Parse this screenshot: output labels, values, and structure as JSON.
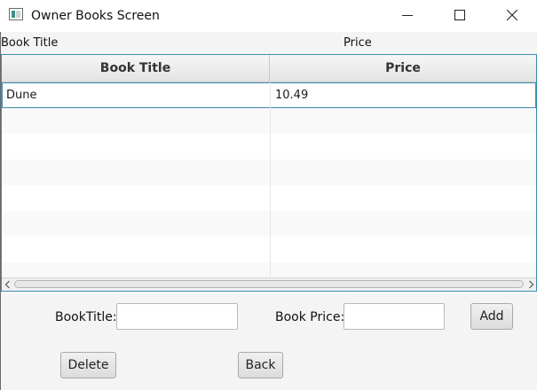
{
  "window": {
    "title": "Owner Books Screen"
  },
  "labels": {
    "book_title": "Book Title",
    "price": "Price"
  },
  "table": {
    "columns": [
      "Book Title",
      "Price"
    ],
    "rows": [
      [
        "Dune",
        "10.49"
      ]
    ],
    "empty_rows": 7,
    "selected_row": 0
  },
  "form": {
    "book_title_label": "BookTitle:",
    "book_title_value": "",
    "book_price_label": "Book Price:",
    "book_price_value": "",
    "add_label": "Add",
    "delete_label": "Delete",
    "back_label": "Back"
  },
  "icons": {
    "app": "application-window-icon",
    "minimize": "minimize-icon",
    "maximize": "maximize-icon",
    "close": "close-icon",
    "scroll_left": "chevron-left-icon",
    "scroll_right": "chevron-right-icon"
  },
  "colors": {
    "accent": "#3d8fb0",
    "window_bg": "#f4f4f4",
    "header_bg": "#e9e9e9"
  }
}
